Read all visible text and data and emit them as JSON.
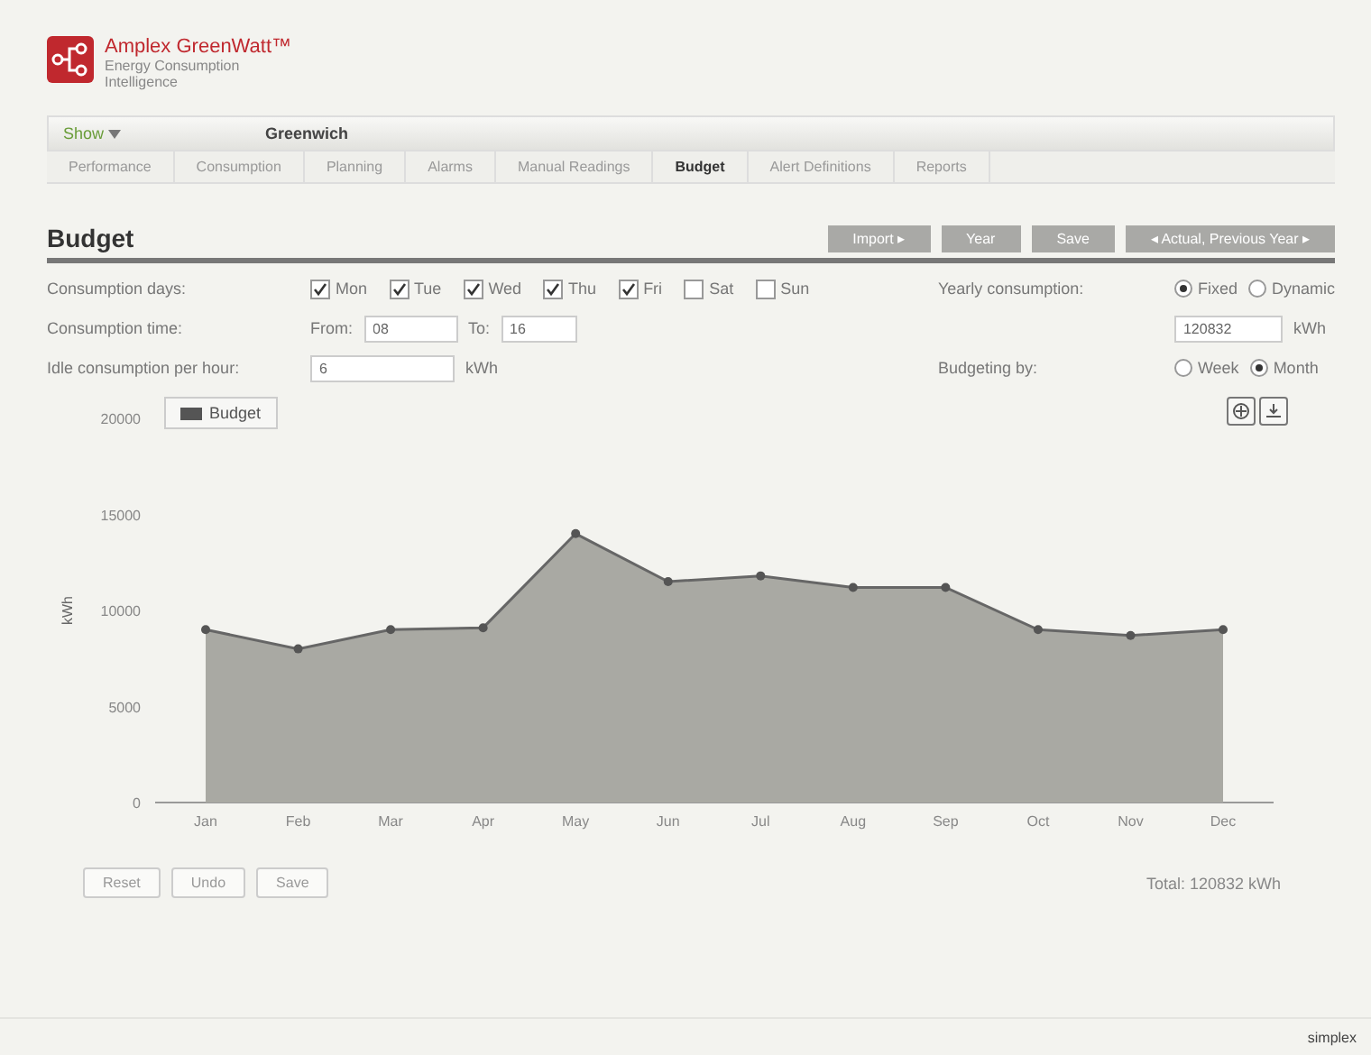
{
  "brand": {
    "name": "Amplex GreenWatt™",
    "tagline": "Energy Consumption Intelligence"
  },
  "toolbar": {
    "show": "Show",
    "site": "Greenwich"
  },
  "tabs": [
    {
      "label": "Performance",
      "selected": false
    },
    {
      "label": "Consumption",
      "selected": false
    },
    {
      "label": "Planning",
      "selected": false
    },
    {
      "label": "Alarms",
      "selected": false
    },
    {
      "label": "Manual Readings",
      "selected": false
    },
    {
      "label": "Budget",
      "selected": true
    },
    {
      "label": "Alert Definitions",
      "selected": false
    },
    {
      "label": "Reports",
      "selected": false
    }
  ],
  "page_title": "Budget",
  "actions": [
    "Import ▸",
    "Year",
    "Save",
    "◂  Actual, Previous Year  ▸"
  ],
  "form": {
    "days_label": "Consumption days:",
    "days": [
      {
        "label": "Mon",
        "checked": true
      },
      {
        "label": "Tue",
        "checked": true
      },
      {
        "label": "Wed",
        "checked": true
      },
      {
        "label": "Thu",
        "checked": true
      },
      {
        "label": "Fri",
        "checked": true
      },
      {
        "label": "Sat",
        "checked": false
      },
      {
        "label": "Sun",
        "checked": false
      }
    ],
    "time_label": "Consumption time:",
    "from_label": "From:",
    "from": "08",
    "to_label": "To:",
    "to": "16",
    "idle_label": "Idle consumption per hour:",
    "idle": "6",
    "idle_unit": "kWh",
    "yearly_label": "Yearly consumption:",
    "yearly_options": [
      {
        "label": "Fixed",
        "selected": true
      },
      {
        "label": "Dynamic",
        "selected": false
      }
    ],
    "yearly_value": "120832",
    "yearly_unit": "kWh",
    "budgeting_label": "Budgeting by:",
    "budgeting_options": [
      {
        "label": "Week",
        "selected": false
      },
      {
        "label": "Month",
        "selected": true
      }
    ]
  },
  "chart": {
    "chart_data": {
      "type": "area",
      "ylabel": "kWh",
      "categories": [
        "Jan",
        "Feb",
        "Mar",
        "Apr",
        "May",
        "Jun",
        "Jul",
        "Aug",
        "Sep",
        "Oct",
        "Nov",
        "Dec"
      ],
      "series": [
        {
          "name": "Budget",
          "color": "#a9a9a3",
          "values": [
            9000,
            8000,
            9000,
            9100,
            14000,
            11500,
            11800,
            11200,
            11200,
            9000,
            8700,
            9000
          ]
        }
      ],
      "ylim": [
        0,
        20000
      ],
      "yticks": [
        0,
        5000,
        10000,
        15000,
        20000
      ]
    }
  },
  "bottom_buttons": [
    "Reset",
    "Undo",
    "Save"
  ],
  "total": "Total: 120832 kWh",
  "footer": "simplex"
}
